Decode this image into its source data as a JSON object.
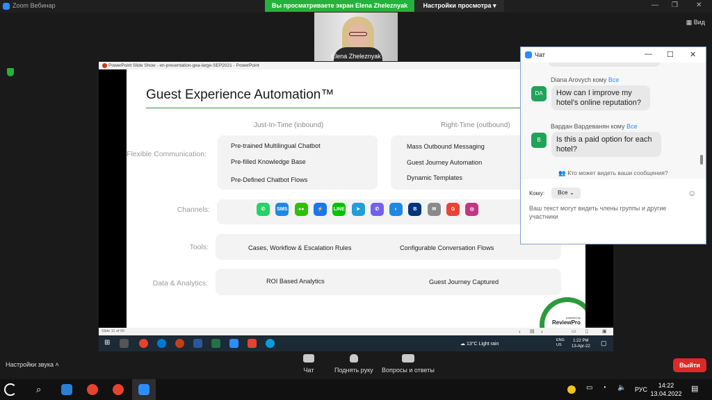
{
  "zoom": {
    "window_title": "Zoom Вебинар",
    "share_banner": "Вы просматриваете экран Elena Zheleznyak",
    "view_settings": "Настройки просмотра ▾",
    "view_label": "Вид",
    "participant_name": "Elena Zheleznyak"
  },
  "powerpoint": {
    "window_title": "PowerPoint Slide Show  -  en-presentation-gea-large-SEP2021  -  PowerPoint",
    "slide_counter": "Slide 11 of 60"
  },
  "slide": {
    "title": "Guest Experience Automation™",
    "col_inbound": "Just-In-Time (inbound)",
    "col_outbound": "Right-Time (outbound)",
    "row_communication": "Flexible Communication:",
    "row_channels": "Channels:",
    "row_tools": "Tools:",
    "row_analytics": "Data & Analytics:",
    "inbound_items": [
      "Pre-trained Multilingual Chatbot",
      "Pre-filled Knowledge Base",
      "Pre-Defined Chatbot Flows"
    ],
    "outbound_items": [
      "Mass Outbound Messaging",
      "Guest Journey Automation",
      "Dynamic Templates"
    ],
    "tools_left": "Cases, Workflow & Escalation Rules",
    "tools_right": "Configurable Conversation Flows",
    "analytics_left": "ROI Based Analytics",
    "analytics_right": "Guest Journey Captured",
    "channel_icons": [
      {
        "name": "whatsapp",
        "color": "#25d366",
        "glyph": "✆"
      },
      {
        "name": "sms",
        "color": "#1e88e5",
        "glyph": "SMS"
      },
      {
        "name": "wechat",
        "color": "#2dc100",
        "glyph": "●●"
      },
      {
        "name": "messenger",
        "color": "#1877f2",
        "glyph": "⚡"
      },
      {
        "name": "line",
        "color": "#00c300",
        "glyph": "LINE"
      },
      {
        "name": "telegram",
        "color": "#229ed9",
        "glyph": "➤"
      },
      {
        "name": "viber",
        "color": "#7360f2",
        "glyph": "✆"
      },
      {
        "name": "web",
        "color": "#1e88e5",
        "glyph": "◐"
      },
      {
        "name": "booking",
        "color": "#003580",
        "glyph": "B"
      },
      {
        "name": "email",
        "color": "#8a8a8a",
        "glyph": "✉"
      },
      {
        "name": "google",
        "color": "#ea4335",
        "glyph": "G"
      },
      {
        "name": "instagram",
        "color": "#c13584",
        "glyph": "◎"
      }
    ],
    "logo_small": "powered by",
    "logo_text": "ReviewPro"
  },
  "inner_taskbar": {
    "weather": "13°C  Light rain",
    "lang": "ENG\nUS",
    "time": "1:22 PM",
    "date": "13-Apr-22"
  },
  "chat": {
    "title": "Чат",
    "messages": [
      {
        "sender": "Diana Arovych",
        "to_word": "кому",
        "to": "Все",
        "initials": "DA",
        "text": "How can I improve my hotel's online reputation?"
      },
      {
        "sender": "Вардан Вардеванян",
        "to_word": "кому",
        "to": "Все",
        "initials": "В",
        "text": "Is this a paid option for each hotel?"
      }
    ],
    "privacy_link": "Кто может видеть ваши сообщения?",
    "to_label": "Кому:",
    "to_value": "Все",
    "input_placeholder": "Ваш текст могут видеть члены группы и другие участники"
  },
  "controls": {
    "audio_settings": "Настройки звука",
    "chat": "Чат",
    "raise_hand": "Поднять руку",
    "qa": "Вопросы и ответы",
    "exit": "Выйти"
  },
  "system": {
    "lang": "РУС",
    "time": "14:22",
    "date": "13.04.2022"
  }
}
